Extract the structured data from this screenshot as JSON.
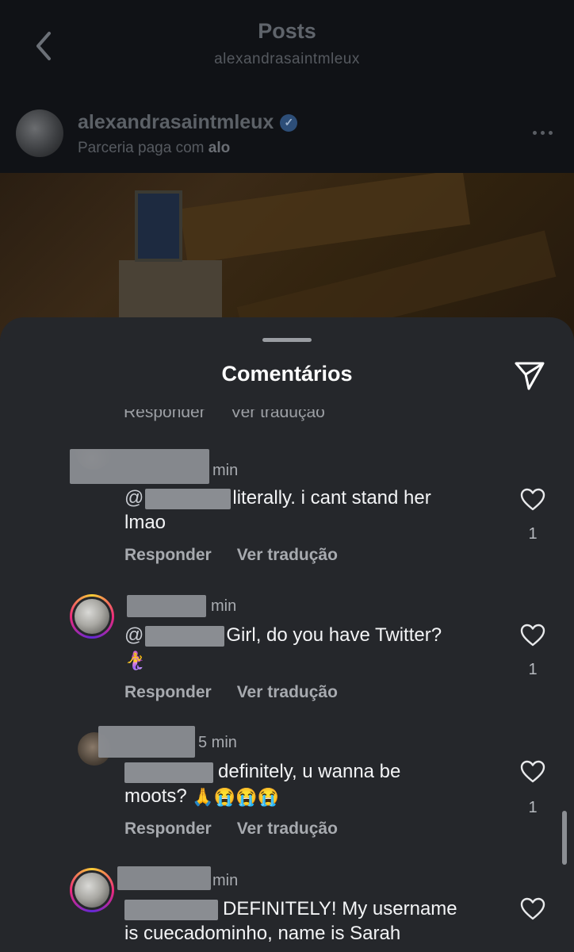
{
  "header": {
    "title": "Posts",
    "subtitle": "alexandrasaintmleux"
  },
  "post": {
    "username": "alexandrasaintmleux",
    "partnership_prefix": "Parceria paga com ",
    "partnership_brand": "alo"
  },
  "sheet": {
    "title": "Comentários",
    "cut_reply": "Responder",
    "cut_translate": "Ver tradução"
  },
  "comments": [
    {
      "time": "min",
      "mention": "@",
      "text_line1": "literally. i cant stand her",
      "text_line2": "lmao",
      "reply": "Responder",
      "translate": "Ver tradução",
      "likes": "1"
    },
    {
      "time": "min",
      "mention": "@",
      "text_line1": "Girl, do you have Twitter?",
      "text_line2": "🧜‍♀️",
      "reply": "Responder",
      "translate": "Ver tradução",
      "likes": "1"
    },
    {
      "time": "5 min",
      "text_line1": "definitely, u wanna be",
      "text_line2": "moots? ",
      "emojis": "🙏😭😭😭",
      "reply": "Responder",
      "translate": "Ver tradução",
      "likes": "1"
    },
    {
      "time": "min",
      "text_line1": "DEFINITELY! My username",
      "text_line2": "is cuecadominho, name is Sarah"
    }
  ],
  "icons": {
    "back": "chevron-left-icon",
    "verified": "verified-badge-icon",
    "more": "more-horizontal-icon",
    "share": "paper-plane-icon",
    "like": "heart-outline-icon"
  }
}
